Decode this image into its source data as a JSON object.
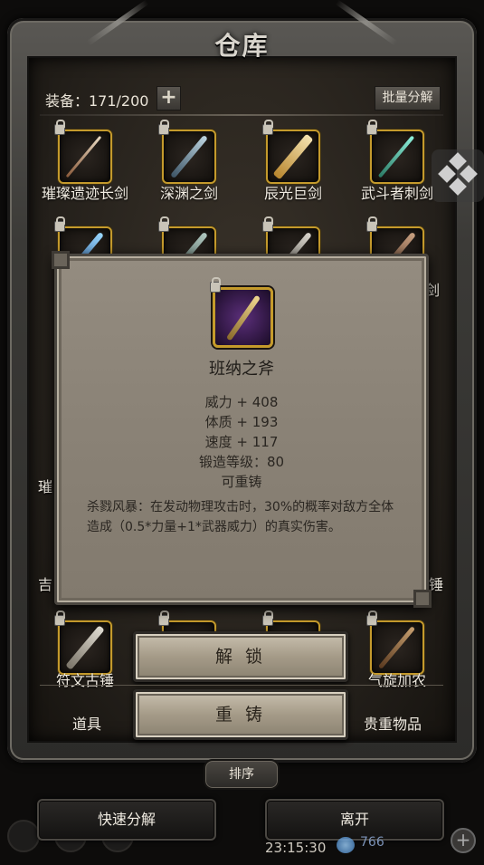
{
  "title": "仓库",
  "header": {
    "equip_label": "装备：171/200",
    "plus_label": "+",
    "batch_label": "批量分解"
  },
  "rows": {
    "row1": [
      "璀璨遗迹长剑",
      "深渊之剑",
      "辰光巨剑",
      "武斗者刺剑"
    ],
    "partial": {
      "right_row2": "剑",
      "left_row4": "璀",
      "left_row5": "吉",
      "right_row5": "锤"
    },
    "row6": [
      "符文古锤",
      "",
      "",
      "气旋加农"
    ]
  },
  "tooltip": {
    "name": "班纳之斧",
    "stats": [
      "威力 + 408",
      "体质 + 193",
      "速度 + 117",
      "锻造等级：80",
      "可重铸"
    ],
    "description": "杀戮风暴：在发动物理攻击时，30%的概率对敌方全体造成（0.5*力量+1*武器威力）的真实伤害。"
  },
  "actions": {
    "unlock": "解 锁",
    "recast": "重 铸"
  },
  "tabs": {
    "left": "道具",
    "right": "贵重物品"
  },
  "sort_label": "排序",
  "quick_decompose": "快速分解",
  "leave": "离开",
  "status": {
    "time": "23:15:30",
    "gems": "766"
  }
}
